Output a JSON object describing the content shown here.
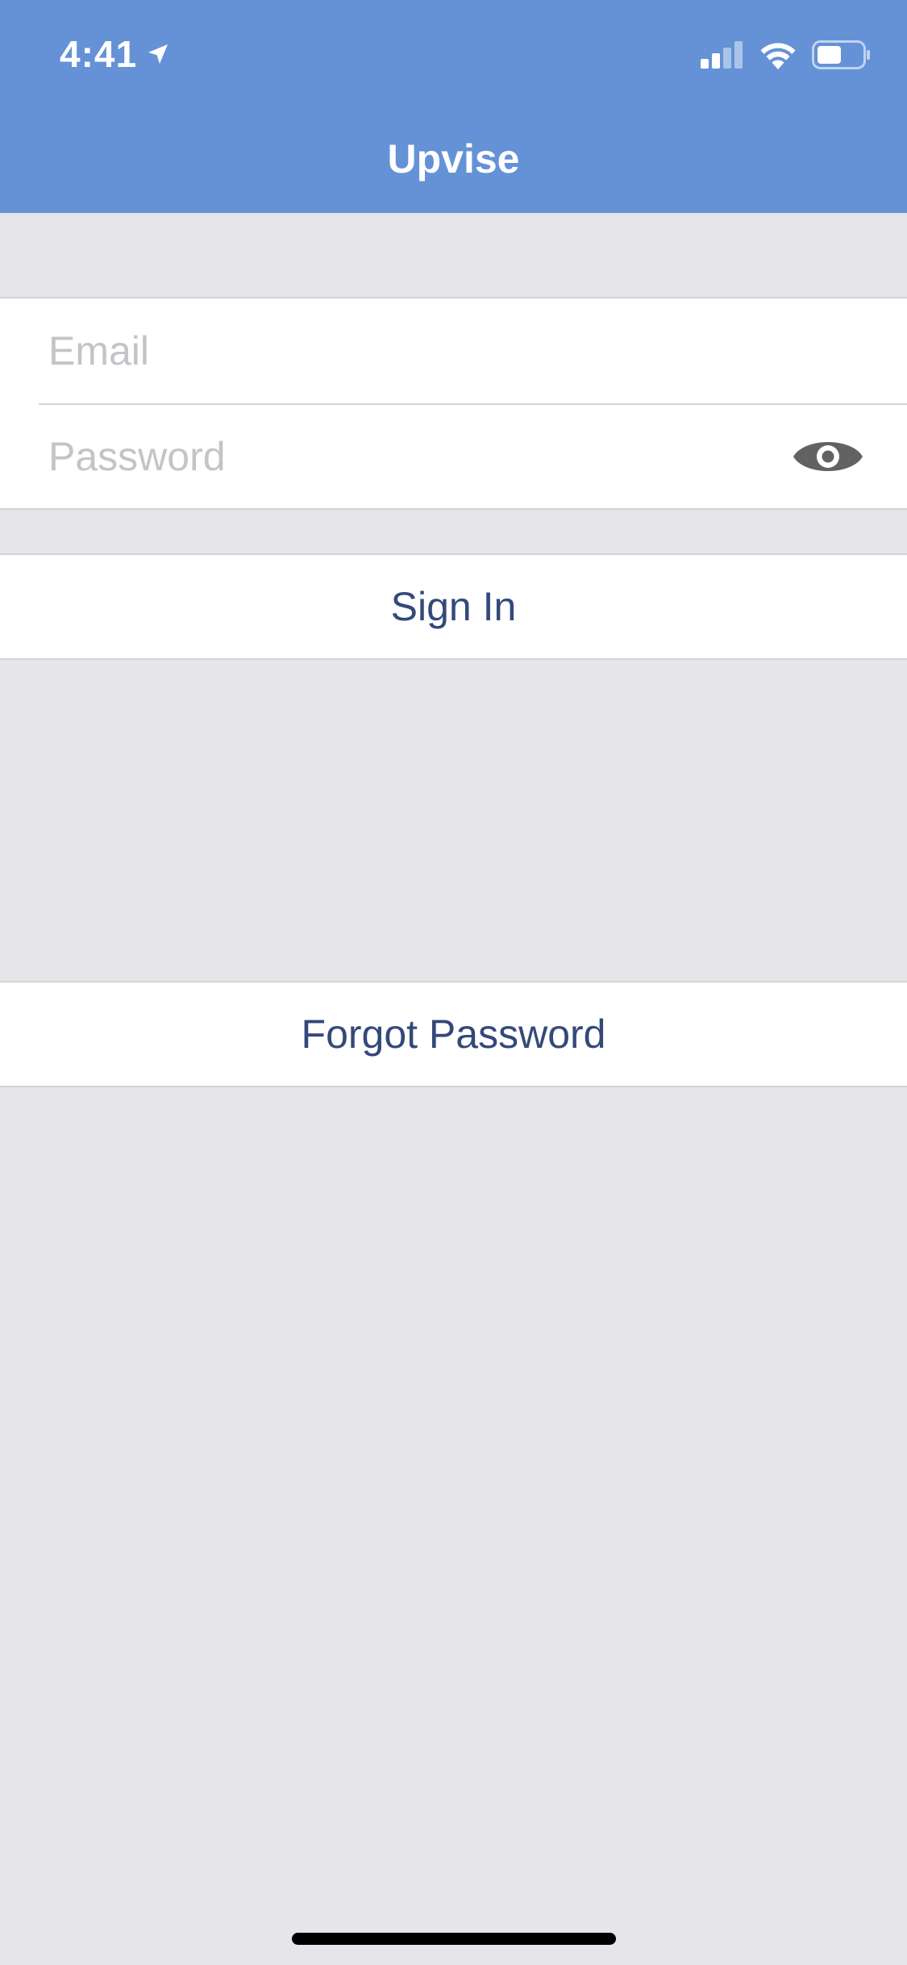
{
  "status_bar": {
    "time": "4:41",
    "location_icon": "location-arrow-icon",
    "signal_icon": "cellular-signal-icon",
    "wifi_icon": "wifi-icon",
    "battery_icon": "battery-icon"
  },
  "nav": {
    "title": "Upvise"
  },
  "form": {
    "email": {
      "value": "",
      "placeholder": "Email"
    },
    "password": {
      "value": "",
      "placeholder": "Password",
      "toggle_icon": "eye-icon"
    }
  },
  "actions": {
    "sign_in_label": "Sign In",
    "forgot_password_label": "Forgot Password"
  },
  "colors": {
    "header_bg": "#6592d6",
    "page_bg": "#e5e5ea",
    "button_text": "#34497a",
    "placeholder": "#c4c4c8",
    "eye_icon": "#626262"
  }
}
